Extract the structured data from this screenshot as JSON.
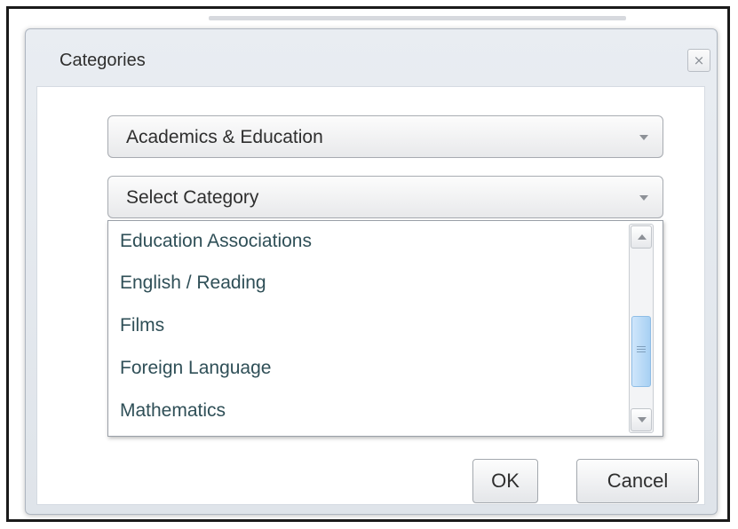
{
  "dialog": {
    "title": "Categories",
    "close_label": "×",
    "primary_select": {
      "value": "Academics & Education"
    },
    "category_select": {
      "value": "Select Category",
      "options": [
        "Education Associations",
        "English / Reading",
        "Films",
        "Foreign Language",
        "Mathematics"
      ]
    },
    "buttons": {
      "ok_label": "OK",
      "cancel_label": "Cancel"
    }
  },
  "icons": {
    "close": "close-icon",
    "dropdown_arrow": "chevron-down-icon",
    "scroll_up": "scroll-up-icon",
    "scroll_down": "scroll-down-icon",
    "scroll_grip": "grip-icon"
  },
  "colors": {
    "dialog_background": "#e9edf2",
    "list_text": "#2f4f57",
    "scroll_thumb": "#a7d0f3",
    "frame": "#1a1a1a"
  }
}
